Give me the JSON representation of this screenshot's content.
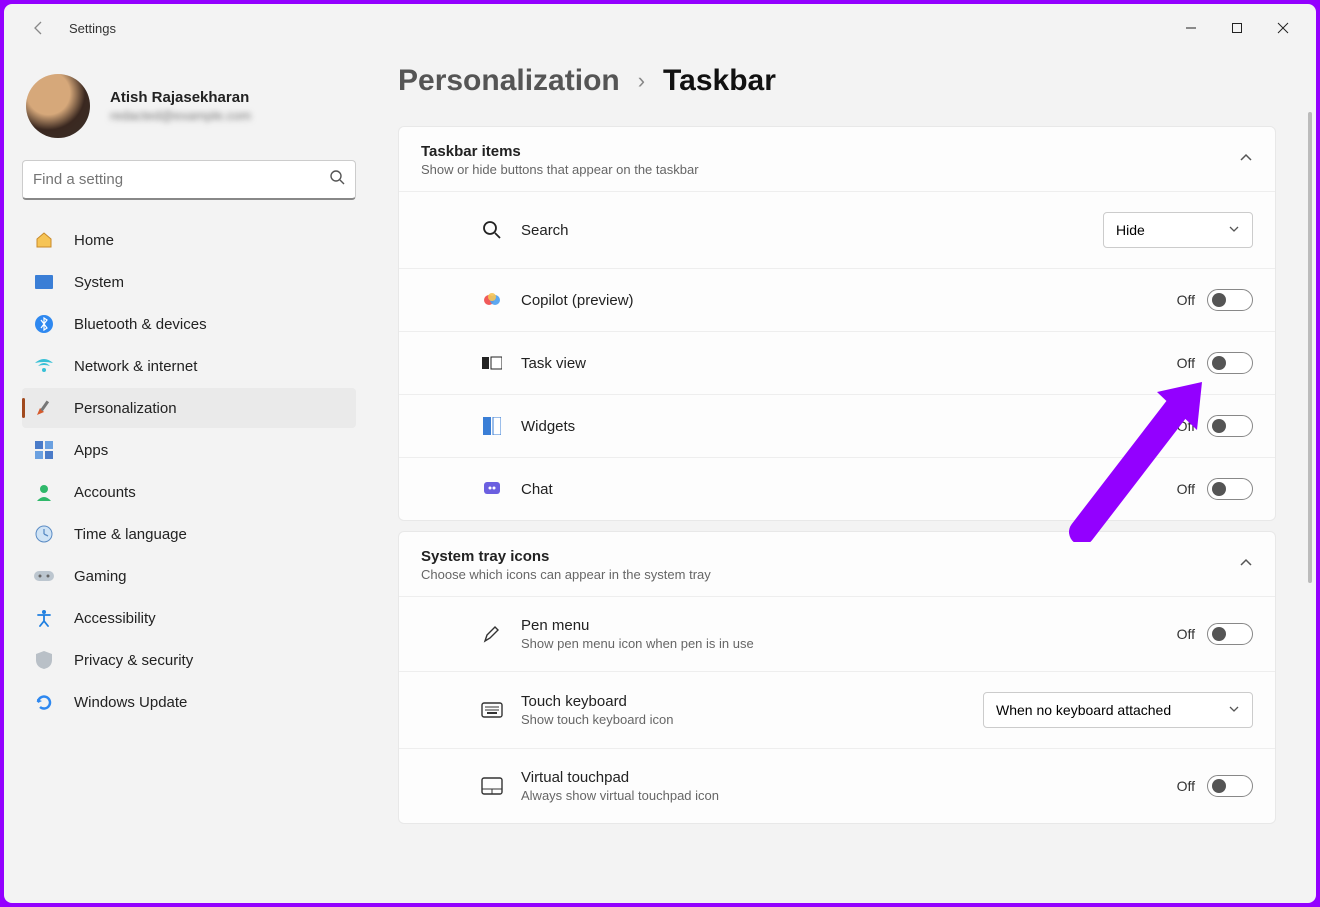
{
  "app": {
    "title": "Settings"
  },
  "profile": {
    "name": "Atish Rajasekharan",
    "email": "redacted@example.com"
  },
  "search": {
    "placeholder": "Find a setting"
  },
  "sidebar": {
    "items": [
      {
        "label": "Home"
      },
      {
        "label": "System"
      },
      {
        "label": "Bluetooth & devices"
      },
      {
        "label": "Network & internet"
      },
      {
        "label": "Personalization"
      },
      {
        "label": "Apps"
      },
      {
        "label": "Accounts"
      },
      {
        "label": "Time & language"
      },
      {
        "label": "Gaming"
      },
      {
        "label": "Accessibility"
      },
      {
        "label": "Privacy & security"
      },
      {
        "label": "Windows Update"
      }
    ]
  },
  "breadcrumb": {
    "parent": "Personalization",
    "current": "Taskbar"
  },
  "sections": {
    "taskbarItems": {
      "title": "Taskbar items",
      "subtitle": "Show or hide buttons that appear on the taskbar",
      "rows": {
        "search": {
          "label": "Search",
          "selectValue": "Hide"
        },
        "copilot": {
          "label": "Copilot (preview)",
          "state": "Off"
        },
        "taskview": {
          "label": "Task view",
          "state": "Off"
        },
        "widgets": {
          "label": "Widgets",
          "state": "Off"
        },
        "chat": {
          "label": "Chat",
          "state": "Off"
        }
      }
    },
    "systemTray": {
      "title": "System tray icons",
      "subtitle": "Choose which icons can appear in the system tray",
      "rows": {
        "pen": {
          "label": "Pen menu",
          "sub": "Show pen menu icon when pen is in use",
          "state": "Off"
        },
        "touchkb": {
          "label": "Touch keyboard",
          "sub": "Show touch keyboard icon",
          "selectValue": "When no keyboard attached"
        },
        "vtp": {
          "label": "Virtual touchpad",
          "sub": "Always show virtual touchpad icon",
          "state": "Off"
        }
      }
    }
  },
  "colors": {
    "annotation": "#9300ff"
  }
}
